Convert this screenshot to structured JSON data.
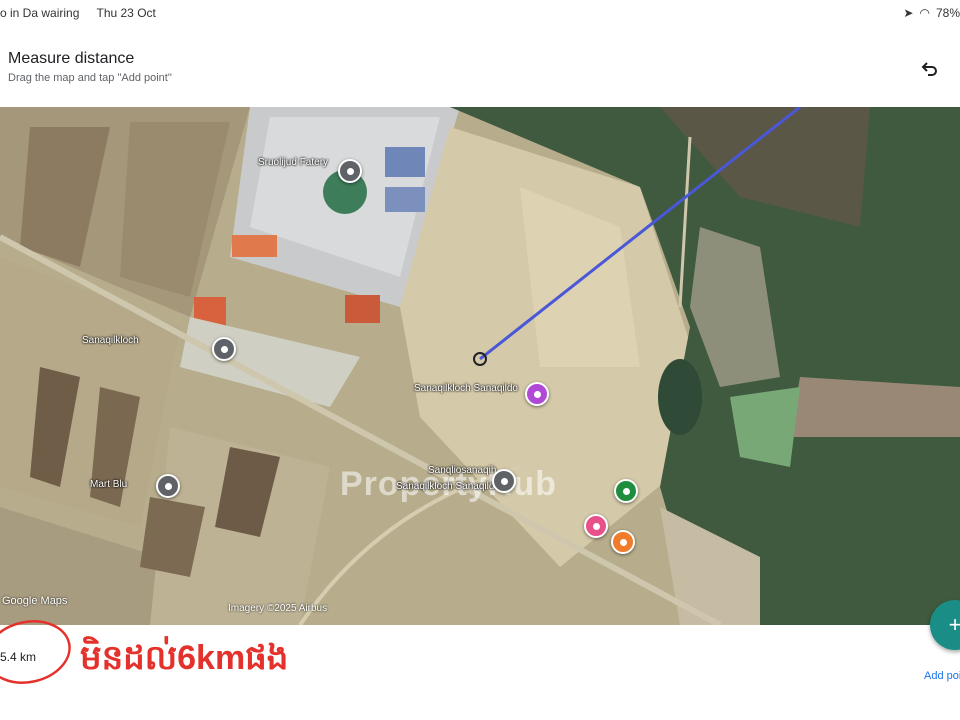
{
  "status_bar": {
    "left_text": "o in Da wairing",
    "date": "Thu 23 Oct",
    "battery": "78%"
  },
  "header": {
    "title": "Measure distance",
    "subtitle": "Drag the map and tap \"Add point\"",
    "undo_icon": "undo-icon"
  },
  "map": {
    "watermark": "PropertyHub",
    "google_logo": "Google Maps",
    "labels": [
      "Sruolijud Fatery",
      "Sanaqilkloch",
      "Sanaqilkloch Sanaqildo",
      "Sanaqilkloch Sanaqildo",
      "Mart Blu",
      "Sanqliosanaqih"
    ],
    "attribution": "Imagery ©2025 Airbus",
    "measure_line_color": "#4a57d6"
  },
  "distance": {
    "value": "5.4 km"
  },
  "annotation": {
    "text": "មិនដល់6kmផង",
    "color": "#e4312b"
  },
  "fab": {
    "icon": "plus-icon",
    "label": "Add point"
  }
}
